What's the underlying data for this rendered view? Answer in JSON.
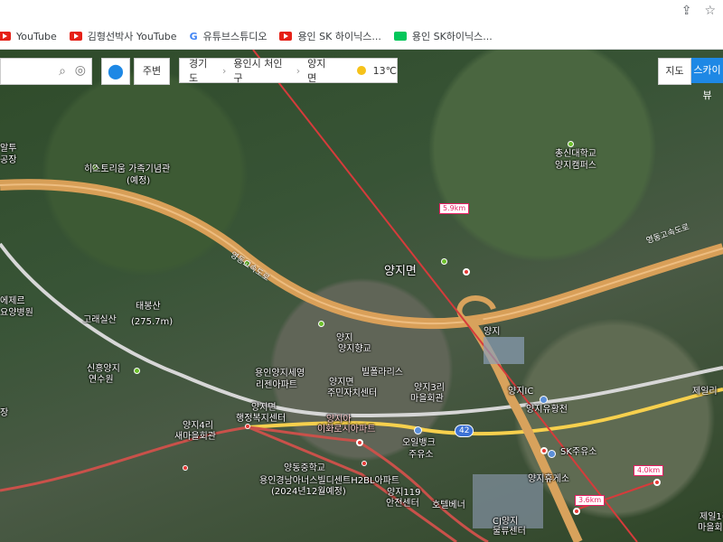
{
  "browser": {
    "icons": [
      "share-icon",
      "star-icon"
    ],
    "bookmarks": [
      {
        "icon": "youtube-icon",
        "label": "YouTube"
      },
      {
        "icon": "youtube-icon",
        "label": "김형선박사 YouTube"
      },
      {
        "icon": "google-icon",
        "label": "유튜브스튜디오"
      },
      {
        "icon": "youtube-icon",
        "label": "용인 SK 하이닉스..."
      },
      {
        "icon": "naver-icon",
        "label": "용인 SK하이닉스..."
      }
    ]
  },
  "toolbar": {
    "search_placeholder": "",
    "nearby": "주변",
    "breadcrumbs": [
      "경기도",
      "용인시 처인구",
      "양지면"
    ],
    "weather": "13℃",
    "tabs": [
      "지도",
      "스카이뷰"
    ]
  },
  "map": {
    "labels": [
      {
        "text": "알투",
        "cls": "small"
      },
      {
        "text": "공장",
        "cls": "small"
      },
      {
        "text": "히스토리움 가족기념관",
        "cls": "small"
      },
      {
        "text": "(예정)",
        "cls": "small"
      },
      {
        "text": "에제르",
        "cls": "small"
      },
      {
        "text": "요양병원",
        "cls": "small"
      },
      {
        "text": "고래실산",
        "cls": "small"
      },
      {
        "text": "태봉산",
        "cls": "small"
      },
      {
        "text": "(275.7m)",
        "cls": "small"
      },
      {
        "text": "신흥양지",
        "cls": "small"
      },
      {
        "text": "연수원",
        "cls": "small"
      },
      {
        "text": "영동고속도로",
        "cls": "small"
      },
      {
        "text": "양지면",
        "cls": "large"
      },
      {
        "text": "총신대학교",
        "cls": "small"
      },
      {
        "text": "양지캠퍼스",
        "cls": "small"
      },
      {
        "text": "영동고속도로",
        "cls": "small"
      },
      {
        "text": "양지",
        "cls": "small"
      },
      {
        "text": "양지IC",
        "cls": "small"
      },
      {
        "text": "양지",
        "cls": "small"
      },
      {
        "text": "양지향교",
        "cls": "small"
      },
      {
        "text": "빌폴라리스",
        "cls": "small"
      },
      {
        "text": "용인양지세영",
        "cls": "small"
      },
      {
        "text": "리젠아파트",
        "cls": "small"
      },
      {
        "text": "양지면",
        "cls": "small"
      },
      {
        "text": "주민자치센터",
        "cls": "small"
      },
      {
        "text": "양지3리",
        "cls": "small"
      },
      {
        "text": "마을회관",
        "cls": "small"
      },
      {
        "text": "양지면",
        "cls": "small"
      },
      {
        "text": "행정복지센터",
        "cls": "small"
      },
      {
        "text": "양지4리",
        "cls": "small"
      },
      {
        "text": "새마을회관",
        "cls": "small"
      },
      {
        "text": "양지아",
        "cls": "small"
      },
      {
        "text": "이화로시아파트",
        "cls": "small"
      },
      {
        "text": "오일뱅크",
        "cls": "small"
      },
      {
        "text": "주유소",
        "cls": "small"
      },
      {
        "text": "양지유황천",
        "cls": "small"
      },
      {
        "text": "SK주유소",
        "cls": "small"
      },
      {
        "text": "양지휴게소",
        "cls": "small"
      },
      {
        "text": "용인경남아너스빌디센트H2BL아파트",
        "cls": "small"
      },
      {
        "text": "(2024년12월예정)",
        "cls": "small"
      },
      {
        "text": "양지119",
        "cls": "small"
      },
      {
        "text": "안전센터",
        "cls": "small"
      },
      {
        "text": "호텔베너",
        "cls": "small"
      },
      {
        "text": "CJ양지",
        "cls": "small"
      },
      {
        "text": "물류센터",
        "cls": "small"
      },
      {
        "text": "제일리",
        "cls": "small"
      },
      {
        "text": "제일1리",
        "cls": "small"
      },
      {
        "text": "마을회",
        "cls": "small"
      },
      {
        "text": "양동중학교",
        "cls": "small"
      },
      {
        "text": "장",
        "cls": "small"
      }
    ],
    "distances": [
      "5.9km",
      "4.0km",
      "3.6km"
    ],
    "route_badge": "42"
  }
}
